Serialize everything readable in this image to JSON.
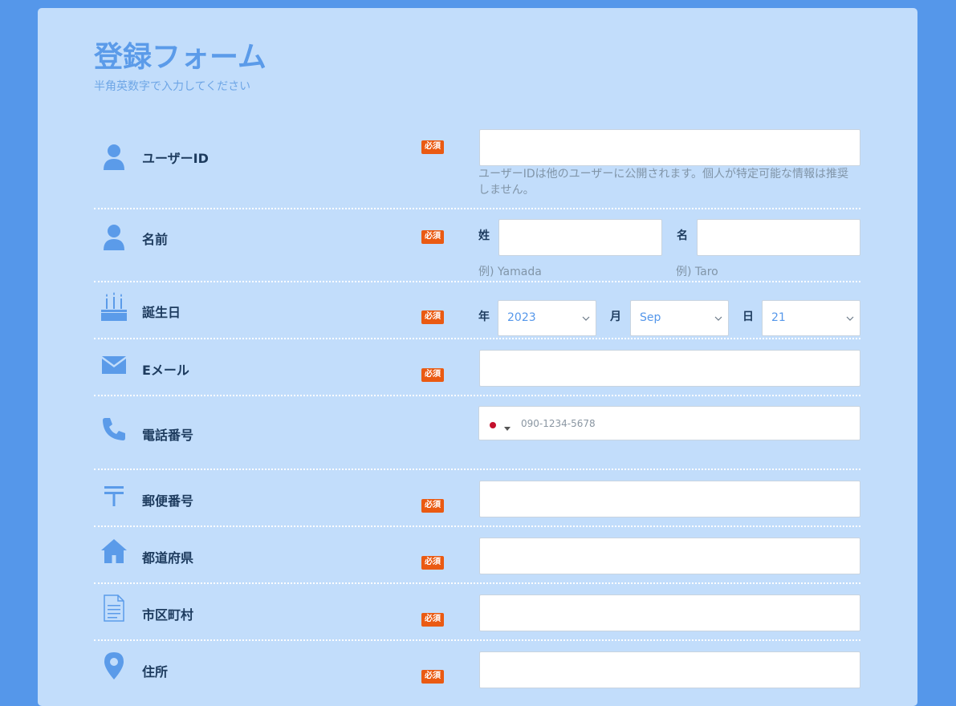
{
  "form": {
    "title": "登録フォーム",
    "subtitle": "半角英数字で入力してください",
    "required_badge": "必須"
  },
  "fields": {
    "user_id": {
      "label": "ユーザーID",
      "icon": "user-icon",
      "value": "",
      "help_line1": "ユーザーIDは他のユーザーに公開されます。個人が特定可能な情報は推奨",
      "help_line2": "しません。"
    },
    "name": {
      "label": "名前",
      "icon": "user-icon",
      "last_label": "姓",
      "first_label": "名",
      "last_value": "",
      "first_value": "",
      "last_example": "例) Yamada",
      "first_example": "例) Taro"
    },
    "birthday": {
      "label": "誕生日",
      "icon": "birthday-cake-icon",
      "year_label": "年",
      "month_label": "月",
      "day_label": "日",
      "year_value": "2023",
      "month_value": "Sep",
      "day_value": "21"
    },
    "email": {
      "label": "Eメール",
      "icon": "envelope-icon",
      "value": ""
    },
    "phone": {
      "label": "電話番号",
      "icon": "phone-icon",
      "country_flag": "jp-flag-icon",
      "placeholder": "090-1234-5678"
    },
    "postal_code": {
      "label": "郵便番号",
      "icon": "postal-mark-icon",
      "value": ""
    },
    "prefecture": {
      "label": "都道府県",
      "icon": "home-icon",
      "value": ""
    },
    "city": {
      "label": "市区町村",
      "icon": "document-icon",
      "value": ""
    },
    "address": {
      "label": "住所",
      "icon": "map-pin-icon",
      "value": ""
    }
  },
  "colors": {
    "page_background": "#5597ea",
    "card_background": "#c2ddfb",
    "accent": "#5b9be9",
    "label_text": "#1d3b5e",
    "required_badge": "#ea5a12",
    "help_text": "#8195a8"
  }
}
